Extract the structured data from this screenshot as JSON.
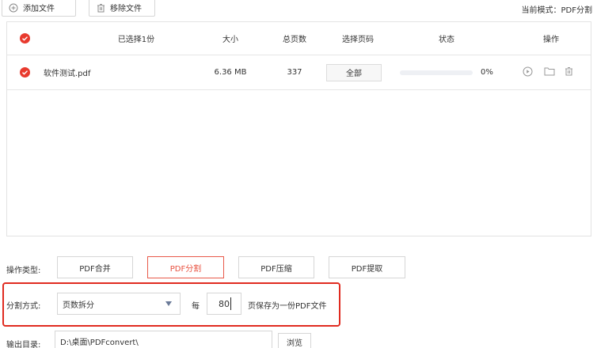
{
  "toolbar": {
    "add_label": "添加文件",
    "remove_label": "移除文件",
    "mode_text": "当前模式：PDF分割"
  },
  "table": {
    "headers": {
      "selected": "已选择1份",
      "size": "大小",
      "pages": "总页数",
      "page_select": "选择页码",
      "status": "状态",
      "actions": "操作"
    },
    "rows": [
      {
        "name": "软件测试.pdf",
        "size": "6.36 MB",
        "pages": "337",
        "page_select": "全部",
        "progress": 0,
        "progress_text": "0%"
      }
    ]
  },
  "operation": {
    "label": "操作类型:",
    "buttons": [
      "PDF合并",
      "PDF分割",
      "PDF压缩",
      "PDF提取"
    ],
    "active": "PDF分割"
  },
  "split": {
    "label": "分割方式:",
    "method": "页数拆分",
    "per_label": "每",
    "pages_value": "80",
    "suffix": "页保存为一份PDF文件"
  },
  "output": {
    "label": "输出目录:",
    "path": "D:\\桌面\\PDFconvert\\",
    "browse_label": "浏览"
  },
  "colors": {
    "accent": "#e83a2e",
    "highlight_border": "#e02b20",
    "progress_track": "#eef0f4"
  },
  "icons": [
    "plus-circle-icon",
    "trash-icon",
    "check-circle-icon",
    "play-icon",
    "folder-icon",
    "delete-icon",
    "dropdown-arrow-icon"
  ]
}
